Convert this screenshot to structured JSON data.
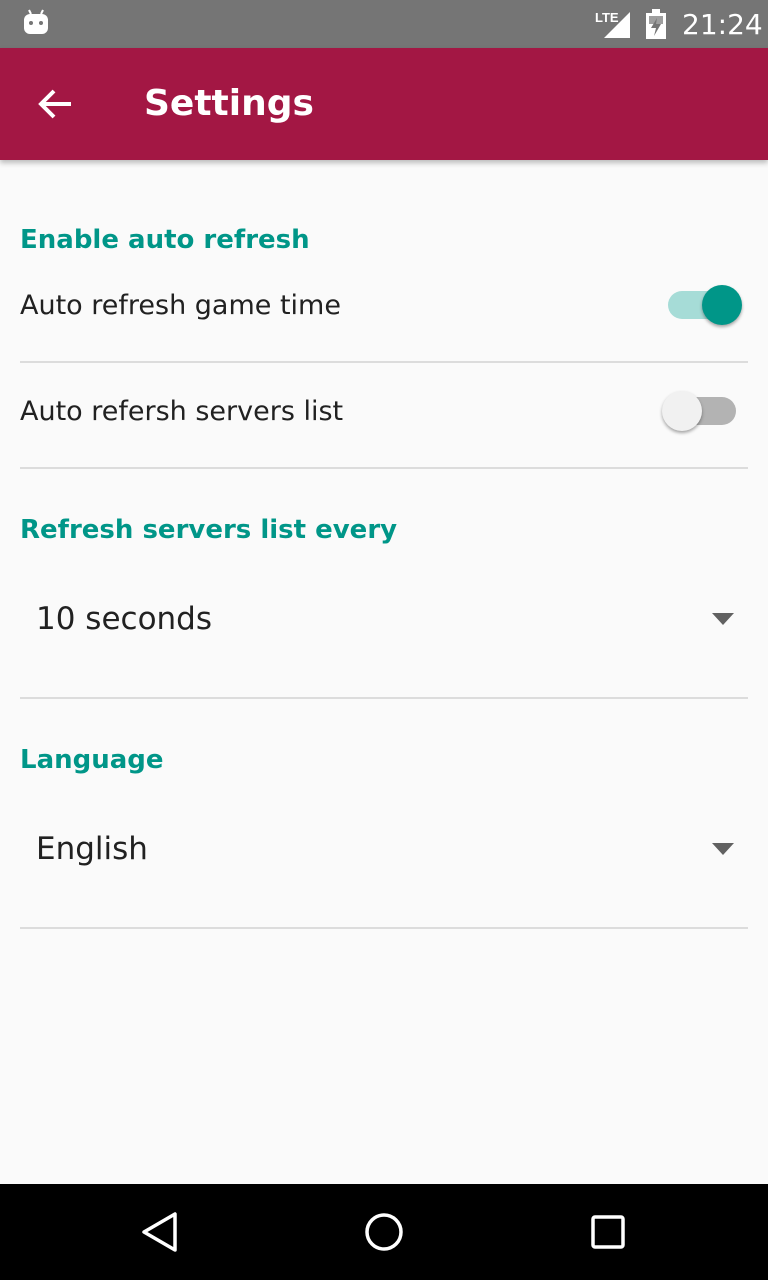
{
  "status_bar": {
    "time": "21:24",
    "network": "LTE",
    "icons": [
      "android-icon",
      "lte-signal-icon",
      "battery-icon"
    ]
  },
  "app_bar": {
    "title": "Settings",
    "back_icon": "arrow-back-icon",
    "color": "#a31744"
  },
  "sections": {
    "auto_refresh": {
      "header": "Enable auto refresh",
      "game_time": {
        "label": "Auto refresh game time",
        "enabled": true
      },
      "servers_list": {
        "label": "Auto refersh servers list",
        "enabled": false
      }
    },
    "refresh_interval": {
      "header": "Refresh servers list every",
      "selected": "10 seconds"
    },
    "language": {
      "header": "Language",
      "selected": "English"
    }
  },
  "nav_bar": {
    "icons": [
      "back-triangle-icon",
      "home-circle-icon",
      "recents-square-icon"
    ]
  },
  "colors": {
    "accent": "#009688",
    "primary": "#a31744",
    "status_bar": "#757575",
    "background": "#fafafa"
  }
}
